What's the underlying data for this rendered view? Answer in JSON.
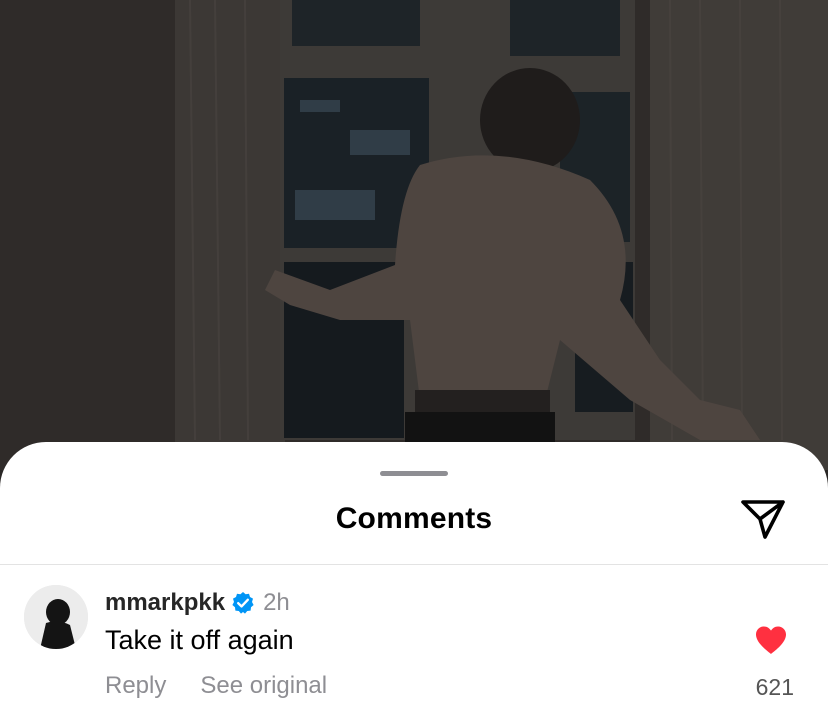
{
  "sheet": {
    "title": "Comments",
    "share_icon": "send-paper-plane-icon"
  },
  "comment": {
    "username": "mmarkpkk",
    "verified": true,
    "time": "2h",
    "text": "Take it off again",
    "reply_label": "Reply",
    "see_original_label": "See original",
    "likes": "621",
    "liked": true,
    "like_color": "#ff3040",
    "verified_color": "#0095f6"
  }
}
